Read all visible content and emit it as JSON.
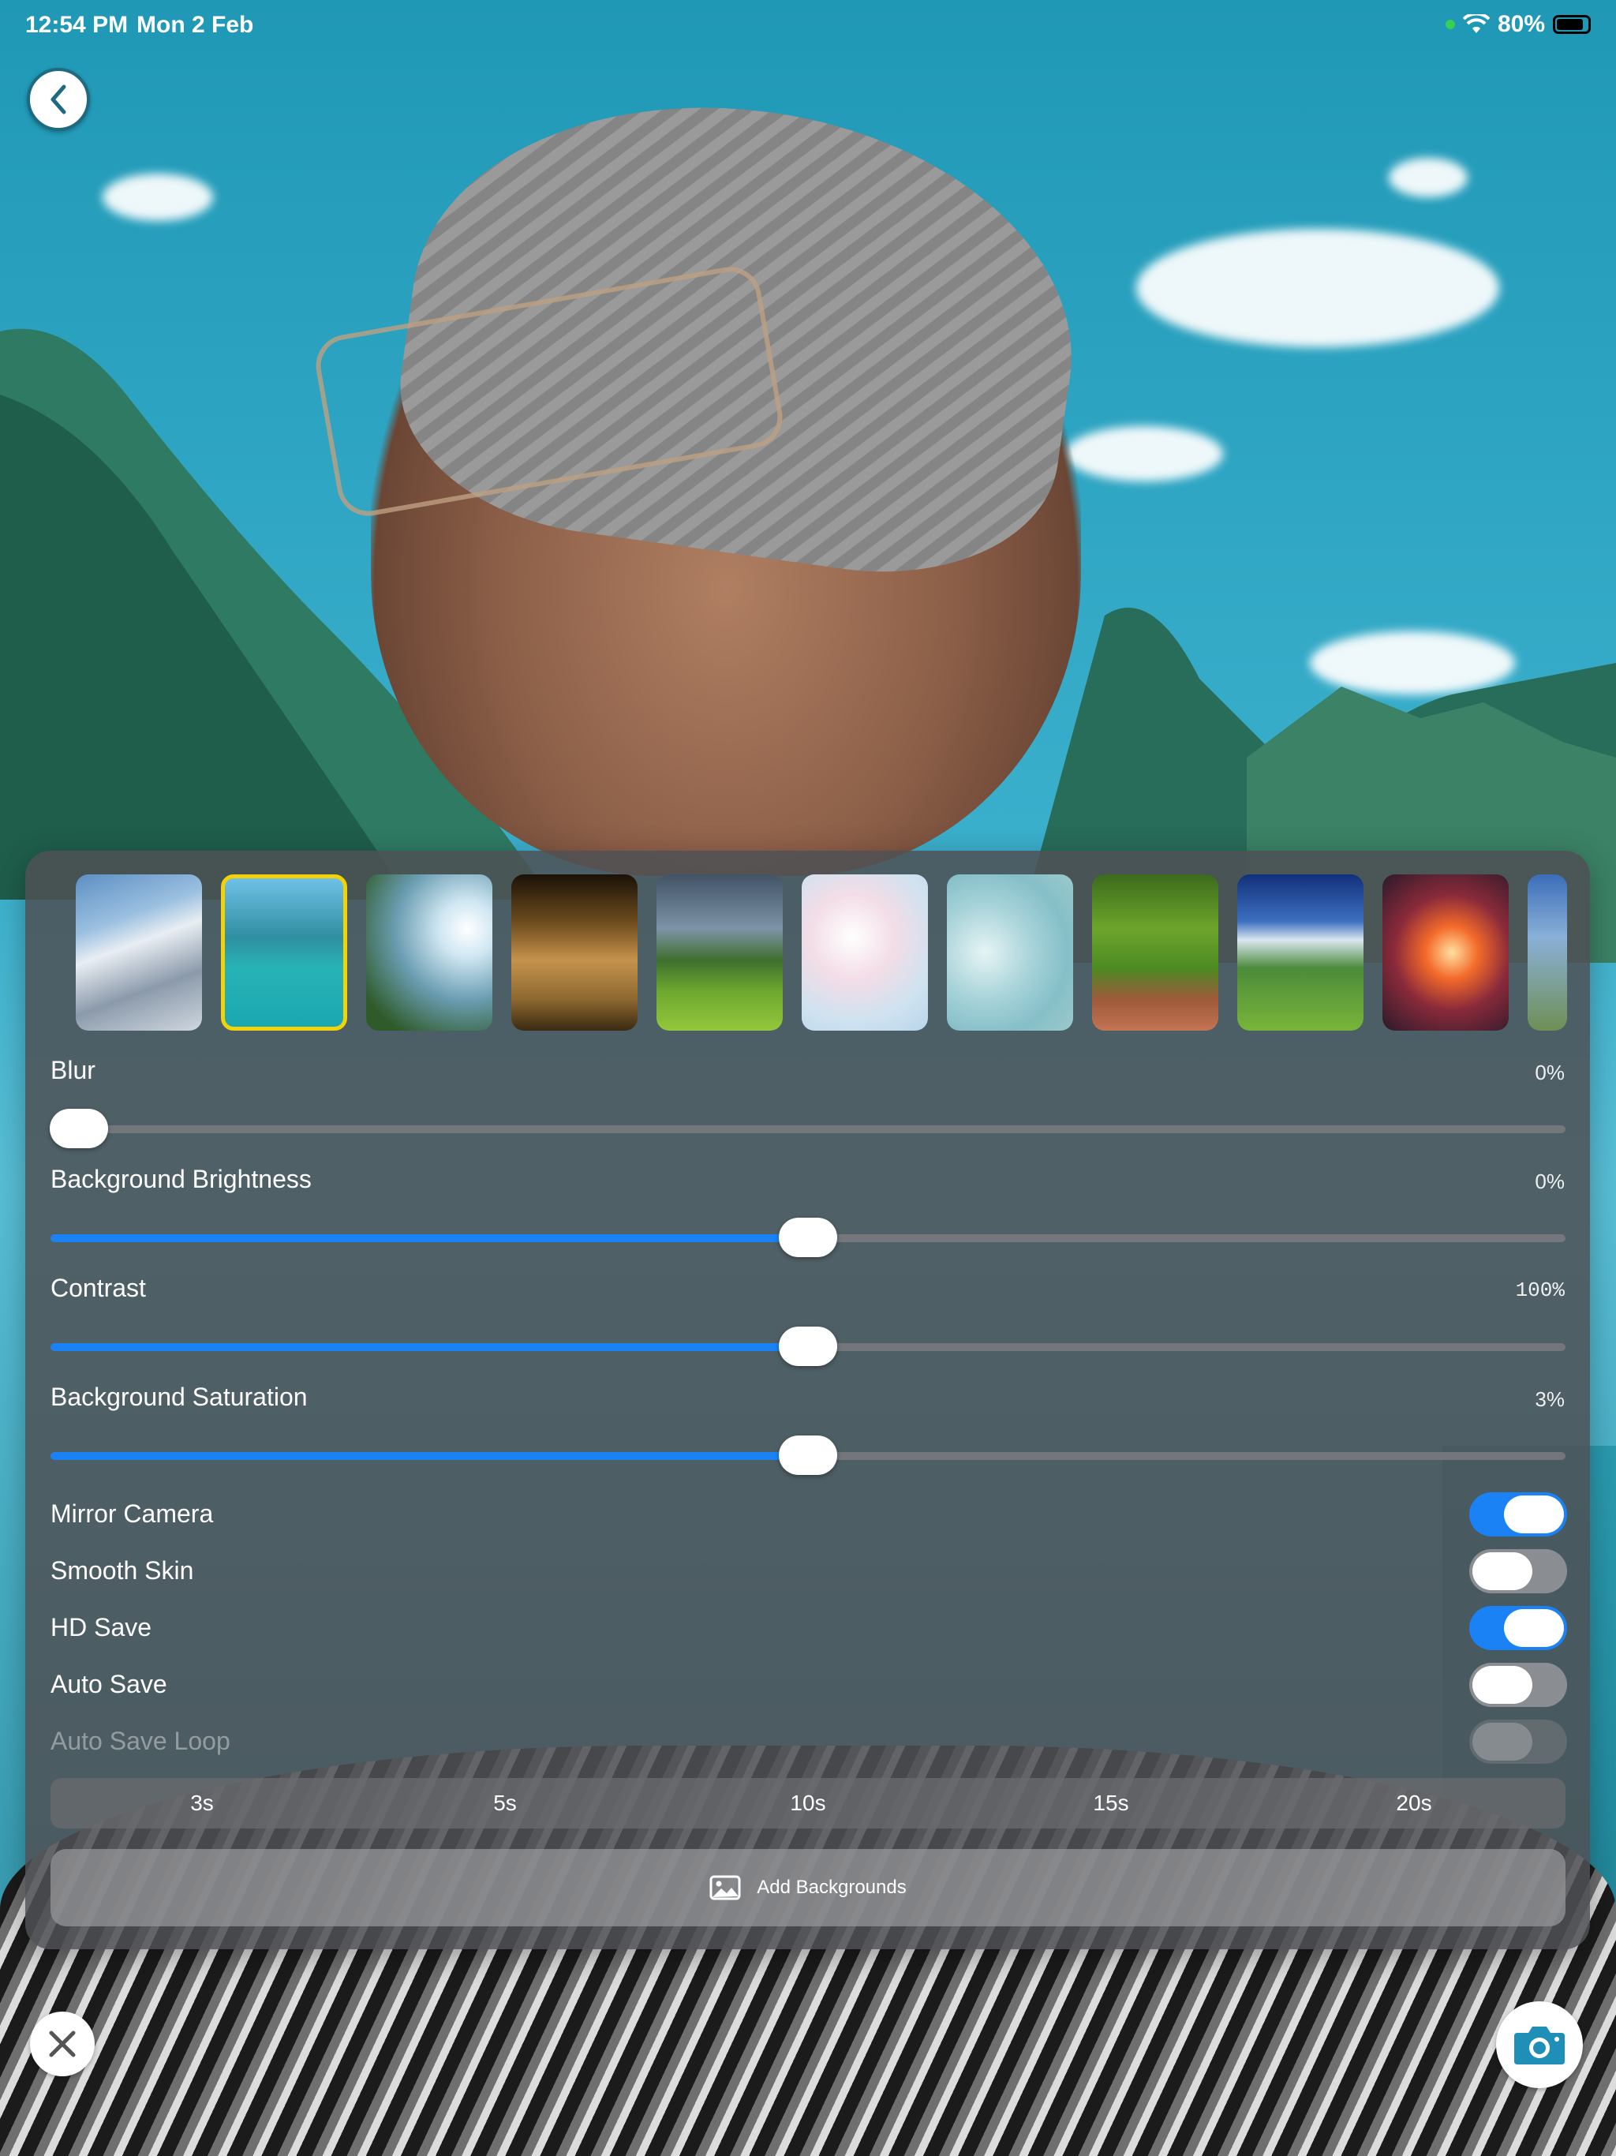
{
  "status_bar": {
    "time": "12:54 PM",
    "date": "Mon 2 Feb",
    "battery_percent": "80%",
    "icons": [
      "green-dot-indicator",
      "wifi-icon",
      "battery-icon"
    ]
  },
  "navigation": {
    "back_icon": "chevron-left-icon",
    "close_icon": "close-icon",
    "camera_icon": "camera-icon"
  },
  "backgrounds": {
    "selected_index": 1,
    "thumbnails": [
      "snowy-mountain-peak",
      "turquoise-lake-boat",
      "tree-sunlit-lake",
      "golden-reflection-lake",
      "green-field-clouds",
      "pastel-bokeh",
      "teal-bokeh-lights",
      "forest-path-flowers",
      "blue-sky-green-hills",
      "sunset-lily-pond",
      "alpine-partial"
    ]
  },
  "sliders": [
    {
      "label": "Blur",
      "value_text": "0%",
      "fill_fraction": 0.0
    },
    {
      "label": "Background Brightness",
      "value_text": "0%",
      "fill_fraction": 0.5
    },
    {
      "label": "Contrast",
      "value_text": "100%",
      "fill_fraction": 0.5
    },
    {
      "label": "Background Saturation",
      "value_text": "3%",
      "fill_fraction": 0.5
    }
  ],
  "toggles": [
    {
      "label": "Mirror Camera",
      "state": "on"
    },
    {
      "label": "Smooth Skin",
      "state": "off"
    },
    {
      "label": "HD Save",
      "state": "on"
    },
    {
      "label": "Auto Save",
      "state": "off"
    },
    {
      "label": "Auto Save Loop",
      "state": "disabled"
    }
  ],
  "loop_intervals": [
    "3s",
    "5s",
    "10s",
    "15s",
    "20s"
  ],
  "add_backgrounds": {
    "label": "Add Backgrounds",
    "icon": "photo-icon"
  },
  "colors": {
    "accent": "#1A82F5",
    "selected_border": "#F3D20A"
  }
}
